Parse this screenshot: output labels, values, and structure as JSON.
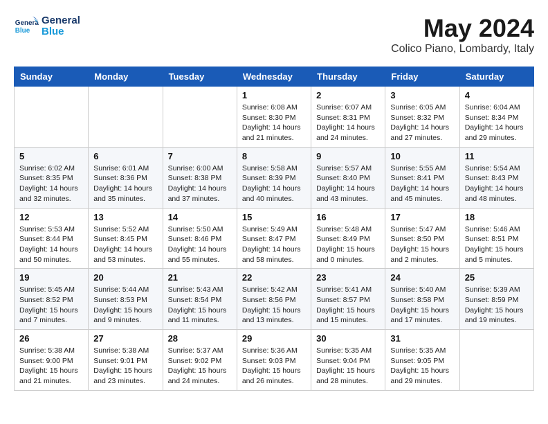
{
  "header": {
    "logo_line1": "General",
    "logo_line2": "Blue",
    "month_year": "May 2024",
    "location": "Colico Piano, Lombardy, Italy"
  },
  "weekdays": [
    "Sunday",
    "Monday",
    "Tuesday",
    "Wednesday",
    "Thursday",
    "Friday",
    "Saturday"
  ],
  "weeks": [
    [
      {
        "day": "",
        "info": ""
      },
      {
        "day": "",
        "info": ""
      },
      {
        "day": "",
        "info": ""
      },
      {
        "day": "1",
        "info": "Sunrise: 6:08 AM\nSunset: 8:30 PM\nDaylight: 14 hours\nand 21 minutes."
      },
      {
        "day": "2",
        "info": "Sunrise: 6:07 AM\nSunset: 8:31 PM\nDaylight: 14 hours\nand 24 minutes."
      },
      {
        "day": "3",
        "info": "Sunrise: 6:05 AM\nSunset: 8:32 PM\nDaylight: 14 hours\nand 27 minutes."
      },
      {
        "day": "4",
        "info": "Sunrise: 6:04 AM\nSunset: 8:34 PM\nDaylight: 14 hours\nand 29 minutes."
      }
    ],
    [
      {
        "day": "5",
        "info": "Sunrise: 6:02 AM\nSunset: 8:35 PM\nDaylight: 14 hours\nand 32 minutes."
      },
      {
        "day": "6",
        "info": "Sunrise: 6:01 AM\nSunset: 8:36 PM\nDaylight: 14 hours\nand 35 minutes."
      },
      {
        "day": "7",
        "info": "Sunrise: 6:00 AM\nSunset: 8:38 PM\nDaylight: 14 hours\nand 37 minutes."
      },
      {
        "day": "8",
        "info": "Sunrise: 5:58 AM\nSunset: 8:39 PM\nDaylight: 14 hours\nand 40 minutes."
      },
      {
        "day": "9",
        "info": "Sunrise: 5:57 AM\nSunset: 8:40 PM\nDaylight: 14 hours\nand 43 minutes."
      },
      {
        "day": "10",
        "info": "Sunrise: 5:55 AM\nSunset: 8:41 PM\nDaylight: 14 hours\nand 45 minutes."
      },
      {
        "day": "11",
        "info": "Sunrise: 5:54 AM\nSunset: 8:43 PM\nDaylight: 14 hours\nand 48 minutes."
      }
    ],
    [
      {
        "day": "12",
        "info": "Sunrise: 5:53 AM\nSunset: 8:44 PM\nDaylight: 14 hours\nand 50 minutes."
      },
      {
        "day": "13",
        "info": "Sunrise: 5:52 AM\nSunset: 8:45 PM\nDaylight: 14 hours\nand 53 minutes."
      },
      {
        "day": "14",
        "info": "Sunrise: 5:50 AM\nSunset: 8:46 PM\nDaylight: 14 hours\nand 55 minutes."
      },
      {
        "day": "15",
        "info": "Sunrise: 5:49 AM\nSunset: 8:47 PM\nDaylight: 14 hours\nand 58 minutes."
      },
      {
        "day": "16",
        "info": "Sunrise: 5:48 AM\nSunset: 8:49 PM\nDaylight: 15 hours\nand 0 minutes."
      },
      {
        "day": "17",
        "info": "Sunrise: 5:47 AM\nSunset: 8:50 PM\nDaylight: 15 hours\nand 2 minutes."
      },
      {
        "day": "18",
        "info": "Sunrise: 5:46 AM\nSunset: 8:51 PM\nDaylight: 15 hours\nand 5 minutes."
      }
    ],
    [
      {
        "day": "19",
        "info": "Sunrise: 5:45 AM\nSunset: 8:52 PM\nDaylight: 15 hours\nand 7 minutes."
      },
      {
        "day": "20",
        "info": "Sunrise: 5:44 AM\nSunset: 8:53 PM\nDaylight: 15 hours\nand 9 minutes."
      },
      {
        "day": "21",
        "info": "Sunrise: 5:43 AM\nSunset: 8:54 PM\nDaylight: 15 hours\nand 11 minutes."
      },
      {
        "day": "22",
        "info": "Sunrise: 5:42 AM\nSunset: 8:56 PM\nDaylight: 15 hours\nand 13 minutes."
      },
      {
        "day": "23",
        "info": "Sunrise: 5:41 AM\nSunset: 8:57 PM\nDaylight: 15 hours\nand 15 minutes."
      },
      {
        "day": "24",
        "info": "Sunrise: 5:40 AM\nSunset: 8:58 PM\nDaylight: 15 hours\nand 17 minutes."
      },
      {
        "day": "25",
        "info": "Sunrise: 5:39 AM\nSunset: 8:59 PM\nDaylight: 15 hours\nand 19 minutes."
      }
    ],
    [
      {
        "day": "26",
        "info": "Sunrise: 5:38 AM\nSunset: 9:00 PM\nDaylight: 15 hours\nand 21 minutes."
      },
      {
        "day": "27",
        "info": "Sunrise: 5:38 AM\nSunset: 9:01 PM\nDaylight: 15 hours\nand 23 minutes."
      },
      {
        "day": "28",
        "info": "Sunrise: 5:37 AM\nSunset: 9:02 PM\nDaylight: 15 hours\nand 24 minutes."
      },
      {
        "day": "29",
        "info": "Sunrise: 5:36 AM\nSunset: 9:03 PM\nDaylight: 15 hours\nand 26 minutes."
      },
      {
        "day": "30",
        "info": "Sunrise: 5:35 AM\nSunset: 9:04 PM\nDaylight: 15 hours\nand 28 minutes."
      },
      {
        "day": "31",
        "info": "Sunrise: 5:35 AM\nSunset: 9:05 PM\nDaylight: 15 hours\nand 29 minutes."
      },
      {
        "day": "",
        "info": ""
      }
    ]
  ]
}
